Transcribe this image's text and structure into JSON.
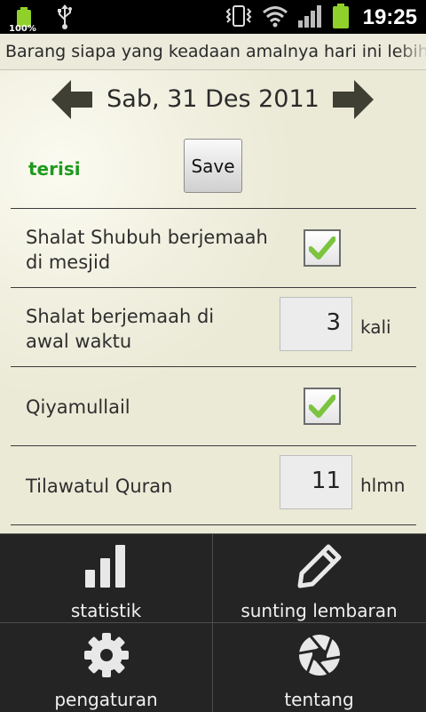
{
  "status_bar": {
    "battery_left_percent": "100%",
    "time": "19:25",
    "icons": [
      "battery-icon",
      "usb-icon",
      "vibrate-icon",
      "wifi-icon",
      "signal-icon",
      "battery-full-icon"
    ]
  },
  "ticker": {
    "text": "Barang siapa yang keadaan amalnya hari ini lebih je"
  },
  "header": {
    "date": "Sab, 31 Des 2011",
    "prev_icon": "arrow-left-icon",
    "next_icon": "arrow-right-icon"
  },
  "form": {
    "status": "terisi",
    "status_color": "#1e9a1e",
    "save_label": "Save",
    "items": [
      {
        "label_line1": "Shalat Shubuh berjemaah",
        "label_line2": "di mesjid",
        "type": "checkbox",
        "checked": true
      },
      {
        "label_line1": "Shalat berjemaah di",
        "label_line2": "awal waktu",
        "type": "number",
        "value": "3",
        "unit": "kali"
      },
      {
        "label": "Qiyamullail",
        "type": "checkbox",
        "checked": true
      },
      {
        "label": "Tilawatul Quran",
        "type": "number",
        "value": "11",
        "unit": "hlmn"
      }
    ]
  },
  "menu": {
    "items": [
      {
        "label": "statistik",
        "icon": "bar-chart-icon"
      },
      {
        "label": "sunting lembaran",
        "icon": "pencil-icon"
      },
      {
        "label": "pengaturan",
        "icon": "gear-icon"
      },
      {
        "label": "tentang",
        "icon": "aperture-icon"
      }
    ]
  },
  "colors": {
    "background": "#ebead7",
    "menu_background": "#242424",
    "checkmark": "#7cc440",
    "arrows": "#3f3f34"
  }
}
